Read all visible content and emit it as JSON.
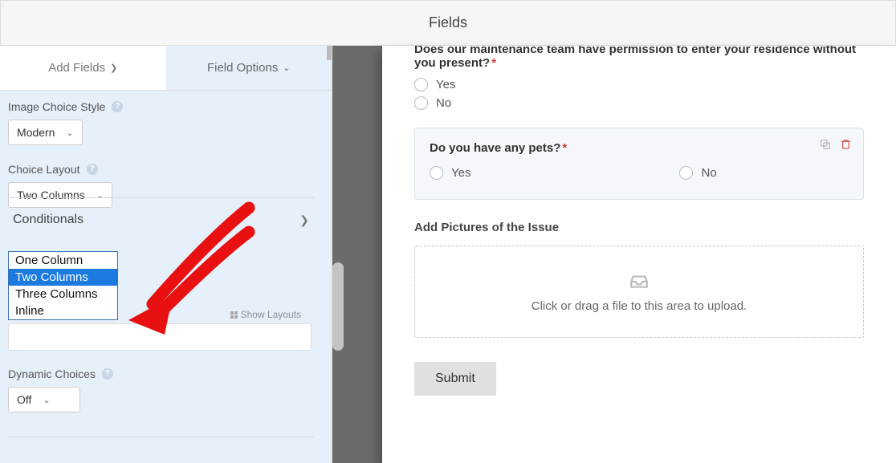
{
  "header": {
    "title": "Fields"
  },
  "tabs": {
    "add_fields": "Add Fields",
    "field_options": "Field Options"
  },
  "image_choice_style": {
    "label": "Image Choice Style",
    "value": "Modern"
  },
  "choice_layout": {
    "label": "Choice Layout",
    "value": "Two Columns",
    "options": [
      "One Column",
      "Two Columns",
      "Three Columns",
      "Inline"
    ],
    "selected_index": 1,
    "show_layouts": "Show Layouts"
  },
  "dynamic_choices": {
    "label": "Dynamic Choices",
    "value": "Off"
  },
  "conditionals": {
    "label": "Conditionals"
  },
  "form": {
    "q1": {
      "label": "Does our maintenance team have permission to enter your residence without you present?",
      "required": "*",
      "options": [
        "Yes",
        "No"
      ]
    },
    "q2": {
      "label": "Do you have any pets?",
      "required": "*",
      "options": [
        "Yes",
        "No"
      ]
    },
    "q3": {
      "label": "Add Pictures of the Issue",
      "dropzone_text": "Click or drag a file to this area to upload."
    },
    "submit": "Submit"
  }
}
